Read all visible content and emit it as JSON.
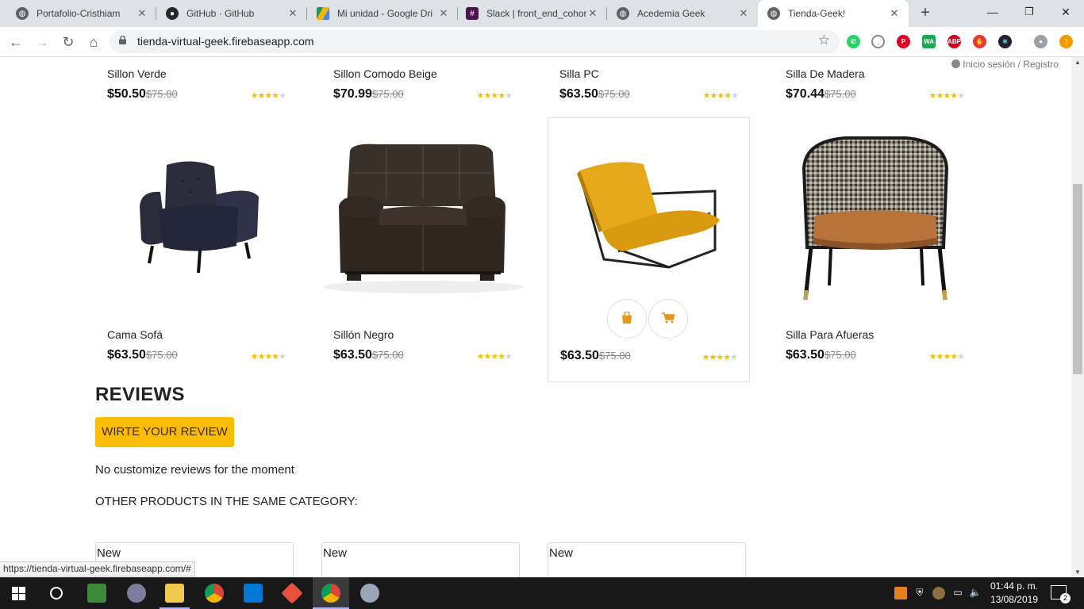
{
  "browser": {
    "tabs": [
      {
        "label": "Portafolio-Cristhiam",
        "close": "✕"
      },
      {
        "label": "GitHub · GitHub",
        "close": "✕"
      },
      {
        "label": "Mi unidad - Google Dri",
        "close": "✕"
      },
      {
        "label": "Slack | front_end_cohor",
        "close": "✕"
      },
      {
        "label": "Acedemia Geek",
        "close": "✕"
      },
      {
        "label": "Tienda-Geek!",
        "close": "✕"
      }
    ],
    "url": "tienda-virtual-geek.firebaseapp.com",
    "status_url": "https://tienda-virtual-geek.firebaseapp.com/#"
  },
  "header": {
    "login_text": "Inicio sesión / Registro"
  },
  "products_top_row": [
    {
      "name": "Sillon Verde",
      "price": "$50.50",
      "old_price": "$75.00",
      "rating": 4
    },
    {
      "name": "Sillon Comodo Beige",
      "price": "$70.99",
      "old_price": "$75.00",
      "rating": 4
    },
    {
      "name": "Silla PC",
      "price": "$63.50",
      "old_price": "$75.00",
      "rating": 4
    },
    {
      "name": "Silla De Madera",
      "price": "$70.44",
      "old_price": "$75.00",
      "rating": 4
    }
  ],
  "products_row2": [
    {
      "name": "Cama Sofá",
      "price": "$63.50",
      "old_price": "$75.00",
      "rating": 4
    },
    {
      "name": "Sillón Negro",
      "price": "$63.50",
      "old_price": "$75.00",
      "rating": 4
    },
    {
      "name": "",
      "price": "$63.50",
      "old_price": "$75.00",
      "rating": 4
    },
    {
      "name": "Silla Para Afueras",
      "price": "$63.50",
      "old_price": "$75.00",
      "rating": 4
    }
  ],
  "reviews": {
    "title": "REVIEWS",
    "button": "WIRTE YOUR REVIEW",
    "empty_text": "No customize reviews for the moment",
    "other_products": "OTHER PRODUCTS IN THE SAME CATEGORY:"
  },
  "related": [
    {
      "badge": "New"
    },
    {
      "badge": "New"
    },
    {
      "badge": "New"
    }
  ],
  "taskbar": {
    "time": "01:44 p. m.",
    "date": "13/08/2019",
    "notifications": "2"
  },
  "colors": {
    "accent_yellow": "#fbbc05",
    "star": "#f2c200",
    "cart_orange": "#e8961e"
  }
}
